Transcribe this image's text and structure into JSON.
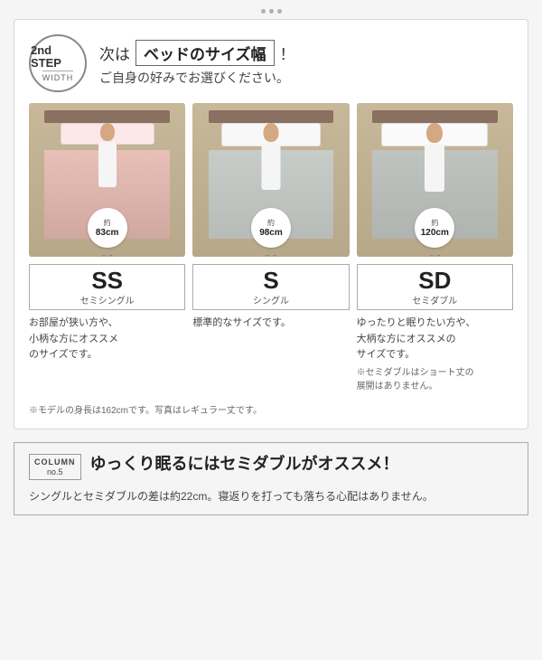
{
  "topDots": 3,
  "step": {
    "number": "2nd STEP",
    "width": "WIDTH",
    "titlePrefix": "次は",
    "titleHighlight": "ベッドのサイズ幅",
    "titleSuffix": "！",
    "subtitle": "ご自身の好みでお選びください。"
  },
  "beds": [
    {
      "widthApprox": "約",
      "widthValue": "83cm",
      "sizeCode": "SS",
      "sizeNameJp": "セミシングル",
      "description": "お部屋が狭い方や、\n小柄な方にオススメ\nのサイズです。",
      "note": ""
    },
    {
      "widthApprox": "約",
      "widthValue": "98cm",
      "sizeCode": "S",
      "sizeNameJp": "シングル",
      "description": "標準的なサイズです。",
      "note": ""
    },
    {
      "widthApprox": "約",
      "widthValue": "120cm",
      "sizeCode": "SD",
      "sizeNameJp": "セミダブル",
      "description": "ゆったりと眠りたい方や、\n大柄な方にオススメの\nサイズです。",
      "note": "※セミダブルはショート丈の\n展開はありません。"
    }
  ],
  "modelNote": "※モデルの身長は162cmです。写真はレギュラー丈です。",
  "column": {
    "labelText": "COLUMN",
    "labelNo": "no.5",
    "title": "ゆっくり眠るにはセミダブルがオススメ！",
    "body": "シングルとセミダブルの差は約22cm。寝返りを打っても落ちる心配はありません。"
  }
}
